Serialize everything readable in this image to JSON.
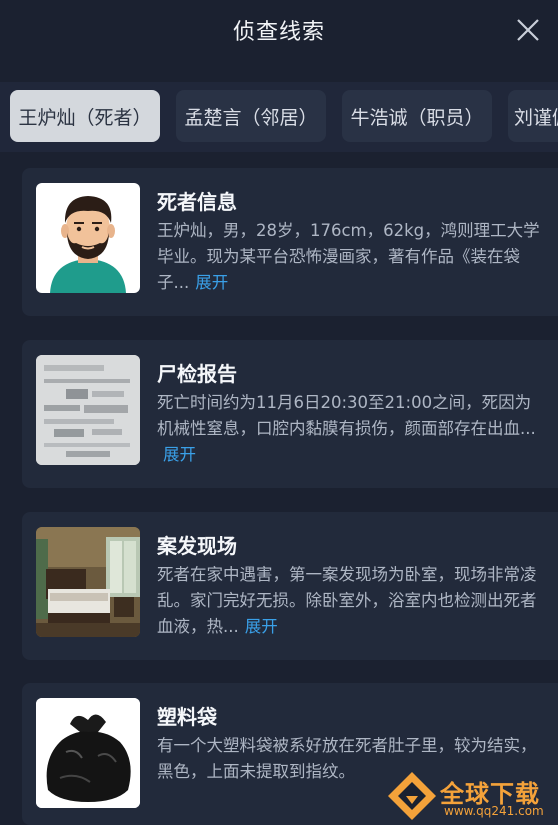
{
  "header": {
    "title": "侦查线索"
  },
  "tabs": [
    {
      "label": "王炉灿（死者）",
      "active": true
    },
    {
      "label": "孟楚言（邻居）",
      "active": false
    },
    {
      "label": "牛浩诚（职员）",
      "active": false
    },
    {
      "label": "刘谨佩",
      "active": false
    }
  ],
  "clues": [
    {
      "title": "死者信息",
      "desc": "王炉灿，男，28岁，176cm，62kg，鸿则理工大学毕业。现为某平台恐怖漫画家，著有作品《装在袋子...",
      "expand": "展开",
      "icon": "avatar-icon"
    },
    {
      "title": "尸检报告",
      "desc": "死亡时间约为11月6日20:30至21:00之间，死因为机械性窒息，口腔内黏膜有损伤，颜面部存在出血...",
      "expand": "展开",
      "icon": "report-document-icon"
    },
    {
      "title": "案发现场",
      "desc": "死者在家中遇害，第一案发现场为卧室，现场非常凌乱。家门完好无损。除卧室外，浴室内也检测出死者血液，热...",
      "expand": "展开",
      "icon": "bedroom-photo-icon"
    },
    {
      "title": "塑料袋",
      "desc": "有一个大塑料袋被系好放在死者肚子里，较为结实，黑色，上面未提取到指纹。",
      "expand": "",
      "icon": "plastic-bag-icon"
    }
  ],
  "watermark": {
    "text": "全球下载",
    "url": "www.qq241.com"
  },
  "colors": {
    "background": "#1b2130",
    "card": "#222a3b",
    "accent": "#3aa0e8",
    "active_tab": "#d4d8dd"
  }
}
